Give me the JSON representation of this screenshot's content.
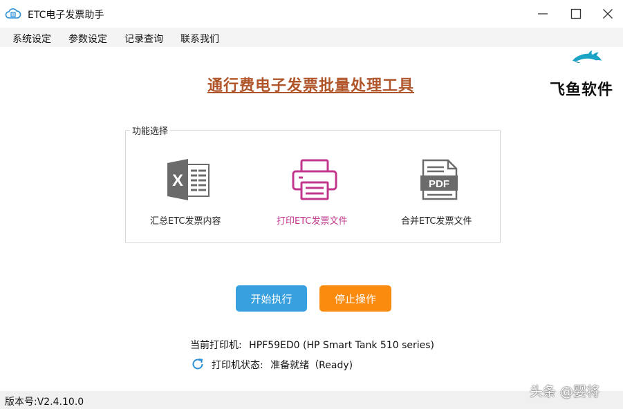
{
  "window": {
    "title": "ETC电子发票助手",
    "icon": "cloud-printer-icon"
  },
  "menu": {
    "items": [
      "系统设定",
      "参数设定",
      "记录查询",
      "联系我们"
    ]
  },
  "header": {
    "title": "通行费电子发票批量处理工具",
    "logo_text": "飞鱼软件",
    "logo_icon": "dolphin-icon"
  },
  "functions": {
    "group_label": "功能选择",
    "items": [
      {
        "label": "汇总ETC发票内容",
        "icon": "excel-icon",
        "color": "#222222"
      },
      {
        "label": "打印ETC发票文件",
        "icon": "printer-icon",
        "color": "#c2378c"
      },
      {
        "label": "合并ETC发票文件",
        "icon": "pdf-icon",
        "color": "#222222"
      }
    ]
  },
  "actions": {
    "start_label": "开始执行",
    "stop_label": "停止操作"
  },
  "printer": {
    "current_label": "当前打印机:",
    "current_value": "HPF59ED0 (HP Smart Tank 510 series)",
    "status_label": "打印机状态:",
    "status_value": "准备就绪（Ready)"
  },
  "status_bar": {
    "version": "版本号:V2.4.10.0"
  },
  "watermark": "头条 @婴将",
  "colors": {
    "title": "#b0552a",
    "accent_pink": "#c2378c",
    "start_button": "#38a0de",
    "stop_button": "#fb8b0f",
    "refresh_icon": "#2a8fd6"
  }
}
